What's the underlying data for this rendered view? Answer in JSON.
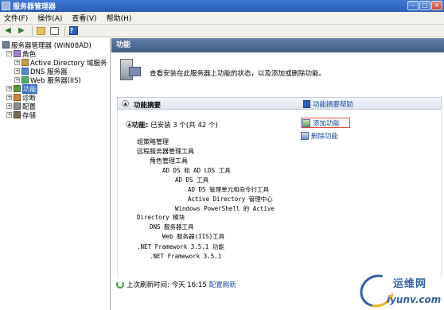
{
  "window": {
    "title": "服务器管理器"
  },
  "menu": [
    "文件(F)",
    "操作(A)",
    "查看(V)",
    "帮助(H)"
  ],
  "tree": {
    "root": "服务器管理器 (WIN08AD)",
    "roles": "角色",
    "role_items": [
      "Active Directory 域服务",
      "DNS 服务器",
      "Web 服务器(IIS)"
    ],
    "features": "功能",
    "diagnostics": "诊断",
    "configuration": "配置",
    "storage": "存储"
  },
  "main": {
    "header": "功能",
    "intro": "查看安装在此服务器上功能的状态，以及添加或删除功能。",
    "section_title": "功能摘要",
    "help_link": "功能摘要帮助",
    "summary_label": "功能:",
    "summary_value": "已安装 3 个(共 42 个)",
    "actions": {
      "add": "添加功能",
      "remove": "删除功能"
    },
    "installed": [
      "组策略管理",
      "远程服务器管理工具",
      "角色管理工具",
      "AD DS 和 AD LDS 工具",
      "AD DS 工具",
      "AD DS 管理单元和命令行工具",
      "Active Directory 管理中心",
      "Windows PowerShell 的 Active",
      "Directory 模块",
      "DNS 服务器工具",
      "Web 服务器(IIS)工具",
      ".NET Framework 3.5.1 功能",
      ".NET Framework 3.5.1"
    ],
    "status_label": "上次刷新时间: 今天 16:15",
    "status_link": "配置刷新"
  },
  "watermark": {
    "title": "运维网",
    "url": "iyunv.com"
  }
}
